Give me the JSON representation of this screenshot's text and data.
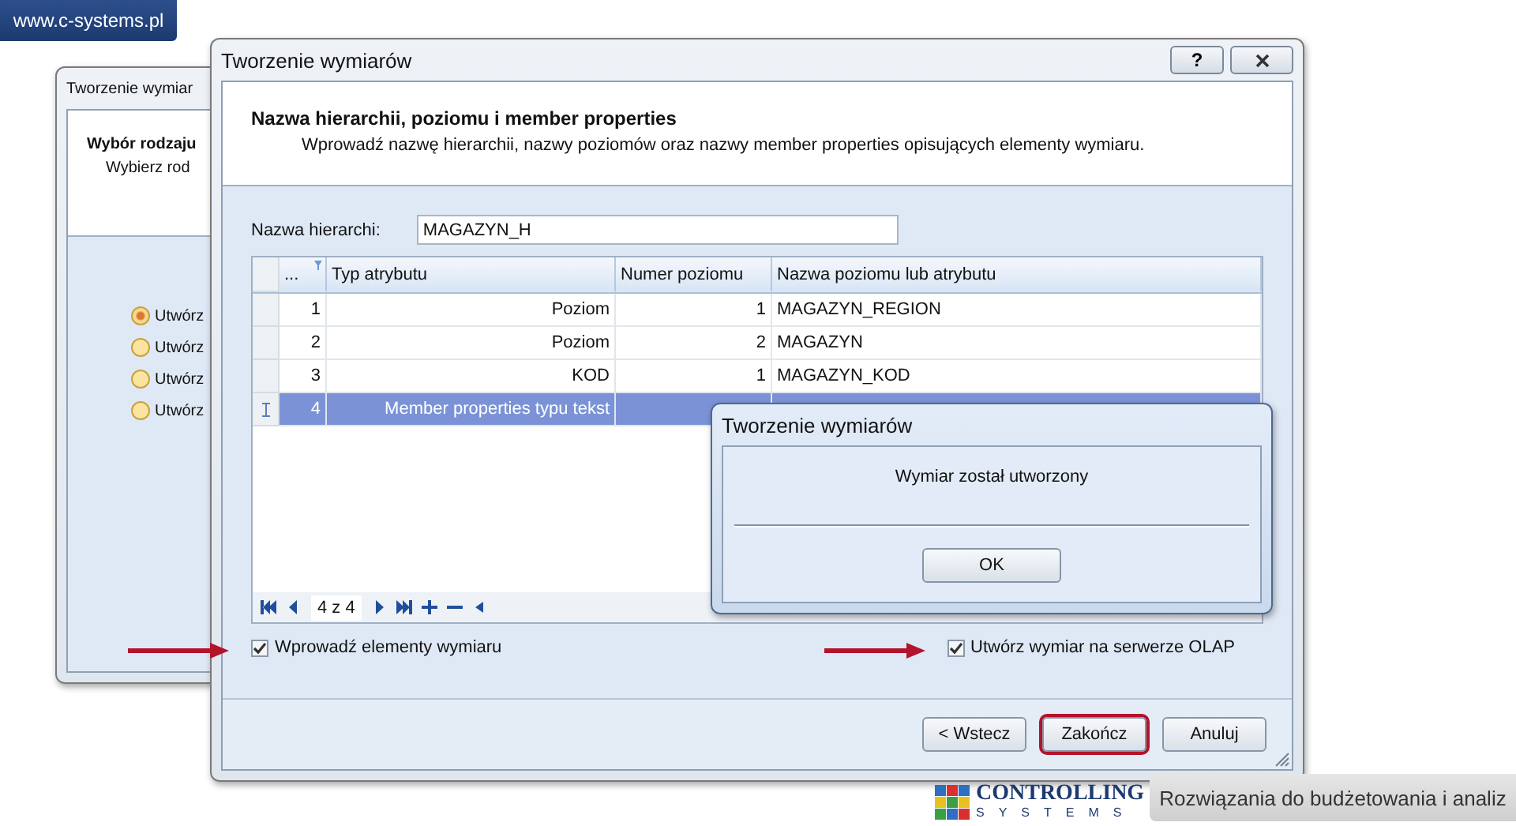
{
  "site_badge": "www.c-systems.pl",
  "back_window": {
    "title": "Tworzenie wymiar",
    "heading": "Wybór rodzaju",
    "subheading": "Wybierz rod",
    "options": [
      {
        "label": "Utwórz",
        "selected": true
      },
      {
        "label": "Utwórz",
        "selected": false
      },
      {
        "label": "Utwórz",
        "selected": false
      },
      {
        "label": "Utwórz",
        "selected": false
      }
    ]
  },
  "window": {
    "title": "Tworzenie wymiarów",
    "help_button": "?"
  },
  "header": {
    "title": "Nazwa hierarchii, poziomu i member properties",
    "subtitle": "Wprowadź nazwę hierarchii, nazwy poziomów oraz nazwy member properties opisujących elementy wymiaru."
  },
  "hierarchy_field": {
    "label": "Nazwa hierarchi:",
    "value": "MAGAZYN_H"
  },
  "table": {
    "columns": [
      "...",
      "Typ atrybutu",
      "Numer poziomu",
      "Nazwa poziomu lub atrybutu"
    ],
    "rows": [
      {
        "cells": [
          "1",
          "Poziom",
          "1",
          "MAGAZYN_REGION"
        ],
        "selected": false
      },
      {
        "cells": [
          "2",
          "Poziom",
          "2",
          "MAGAZYN"
        ],
        "selected": false
      },
      {
        "cells": [
          "3",
          "KOD",
          "1",
          "MAGAZYN_KOD"
        ],
        "selected": false
      },
      {
        "cells": [
          "4",
          "Member properties typu tekst"
        ],
        "selected": true
      }
    ]
  },
  "navigator": {
    "position": "4 z 4"
  },
  "checkboxes": [
    {
      "label": "Wprowadź elementy wymiaru",
      "checked": true,
      "arrow": true
    },
    {
      "label": "Utwórz wymiar na serwerze OLAP",
      "checked": true,
      "arrow": true
    }
  ],
  "buttons": [
    {
      "label": "< Wstecz",
      "highlighted": false
    },
    {
      "label": "Zakończ",
      "highlighted": true
    },
    {
      "label": "Anuluj",
      "highlighted": false
    }
  ],
  "message_dialog": {
    "title": "Tworzenie wymiarów",
    "message": "Wymiar został utworzony",
    "buttons": [
      "OK"
    ]
  },
  "logo": {
    "name": "CONTROLLING",
    "subtitle": "SYSTEMS"
  },
  "tagline": "Rozwiązania do budżetowania i analiz"
}
